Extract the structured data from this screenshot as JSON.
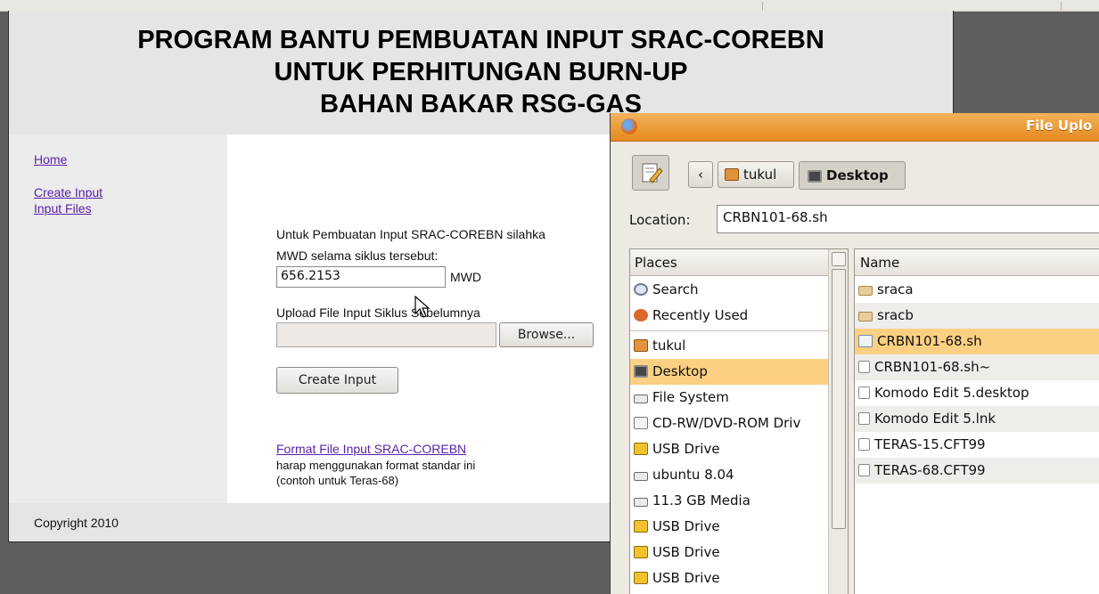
{
  "page": {
    "title_lines": [
      "PROGRAM BANTU PEMBUATAN INPUT SRAC-COREBN",
      "UNTUK PERHITUNGAN BURN-UP",
      "BAHAN BAKAR RSG-GAS"
    ],
    "nav": {
      "home": "Home",
      "create_input": "Create Input",
      "input_files": "Input Files"
    },
    "intro_text": "Untuk Pembuatan Input SRAC-COREBN silahka",
    "mwd_label": "MWD selama siklus tersebut:",
    "mwd_value": "656.2153",
    "mwd_unit": "MWD",
    "upload_label": "Upload File Input Siklus Sebelumnya",
    "upload_value": "",
    "browse_label": "Browse...",
    "create_button": "Create Input",
    "format_link": "Format File Input SRAC-COREBN",
    "format_note_1": "harap menggunakan format standar ini",
    "format_note_2": "(contoh untuk Teras-68)",
    "footer": "Copyright 2010"
  },
  "dialog": {
    "title": "File Uplo",
    "breadcrumb": [
      "tukul",
      "Desktop"
    ],
    "back_glyph": "‹",
    "location_label": "Location:",
    "location_value": "CRBN101-68.sh",
    "places_header": "Places",
    "places": [
      {
        "label": "Search",
        "icon": "search-icon"
      },
      {
        "label": "Recently Used",
        "icon": "recently-used-icon"
      },
      {
        "label": "tukul",
        "icon": "home-folder-icon"
      },
      {
        "label": "Desktop",
        "icon": "desktop-icon",
        "selected": true
      },
      {
        "label": "File System",
        "icon": "drive-icon"
      },
      {
        "label": "CD-RW/DVD-ROM Driv",
        "icon": "optical-drive-icon"
      },
      {
        "label": "USB Drive",
        "icon": "usb-drive-icon"
      },
      {
        "label": "ubuntu 8.04",
        "icon": "drive-icon"
      },
      {
        "label": "11.3 GB Media",
        "icon": "drive-icon"
      },
      {
        "label": "USB Drive",
        "icon": "usb-drive-icon"
      },
      {
        "label": "USB Drive",
        "icon": "usb-drive-icon"
      },
      {
        "label": "USB Drive",
        "icon": "usb-drive-icon"
      }
    ],
    "files_header": "Name",
    "files": [
      {
        "label": "sraca",
        "icon": "folder-icon"
      },
      {
        "label": "sracb",
        "icon": "folder-icon"
      },
      {
        "label": "CRBN101-68.sh",
        "icon": "script-file-icon",
        "selected": true
      },
      {
        "label": "CRBN101-68.sh~",
        "icon": "text-file-icon"
      },
      {
        "label": "Komodo Edit 5.desktop",
        "icon": "text-file-icon"
      },
      {
        "label": "Komodo Edit 5.lnk",
        "icon": "text-file-icon"
      },
      {
        "label": "TERAS-15.CFT99",
        "icon": "text-file-icon"
      },
      {
        "label": "TERAS-68.CFT99",
        "icon": "text-file-icon"
      }
    ]
  },
  "colors": {
    "header_bg": "#e5e5e5",
    "sidebar_bg": "#ececec",
    "link": "#5b1fa8",
    "dialog_title": "#e58a1f",
    "selection": "#fbd082"
  }
}
